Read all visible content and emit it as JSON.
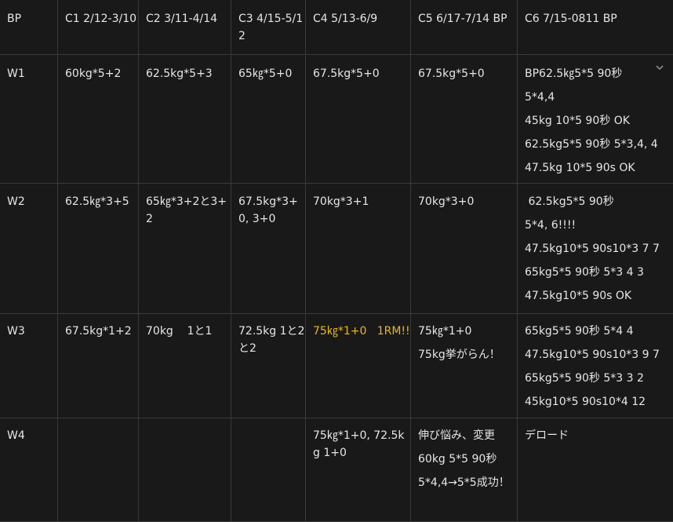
{
  "header": {
    "c0": "BP",
    "c1": "C1 2/12-3/10",
    "c2": "C2 3/11-4/14",
    "c3": "C3 4/15-5/12",
    "c4": "C4 5/13-6/9",
    "c5": "C5 6/17-7/14 BP",
    "c6": "C6 7/15-0811 BP"
  },
  "rows": [
    {
      "label": "W1",
      "c1": "60kg*5+2",
      "c2": "62.5kg*5+3",
      "c3": "65㎏*5+0",
      "c4": "67.5kg*5+0",
      "c5": "67.5kg*5+0",
      "c6": [
        "BP62.5㎏5*5 90秒",
        "5*4,4",
        "45kg 10*5 90秒 OK",
        "62.5kg5*5 90秒 5*3,4, 4",
        "47.5kg 10*5 90s OK"
      ]
    },
    {
      "label": "W2",
      "c1": "62.5㎏*3+5",
      "c2": "65㎏*3+2と3+2",
      "c3": "67.5kg*3+0, 3+0",
      "c4": "70kg*3+1",
      "c5": "70kg*3+0",
      "c6": [
        " 62.5kg5*5 90秒",
        "5*4, 6!!!!",
        "47.5kg10*5 90s10*3 7 7",
        "65kg5*5 90秒 5*3 4 3",
        "47.5kg10*5 90s OK"
      ]
    },
    {
      "label": "W3",
      "c1": "67.5kg*1+2",
      "c2": "70kg    1と1",
      "c3": "72.5kg 1と2と2",
      "c4": "75㎏*1+0   1RM!!",
      "c5": [
        "75㎏*1+0",
        "75kg挙がらん！"
      ],
      "c6": [
        "65kg5*5 90秒 5*4 4",
        "47.5kg10*5 90s10*3 9 7",
        "65kg5*5 90秒 5*3 3 2",
        "45kg10*5 90s10*4 12"
      ]
    },
    {
      "label": "W4",
      "c1": "",
      "c2": "",
      "c3": "",
      "c4": "75㎏*1+0, 72.5kg 1+0",
      "c5": [
        "伸び悩み、変更",
        "60kg 5*5 90秒",
        "5*4,4→5*5成功！"
      ],
      "c6": "デロード"
    }
  ],
  "icons": {
    "expand": "chevron-down-icon"
  },
  "colors": {
    "background": "#191919",
    "text": "#e6e6e6",
    "highlight": "#e6b81f",
    "border": "#3a3a3a"
  }
}
